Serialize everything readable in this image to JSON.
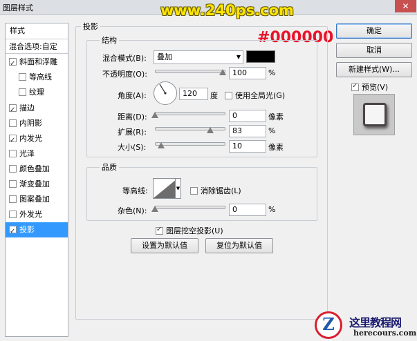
{
  "window": {
    "title": "图层样式",
    "close_glyph": "✕",
    "watermark": "www.240ps.com",
    "color_overlay_text": "#000000"
  },
  "sidebar": {
    "header": "样式",
    "blend_options": "混合选项:自定",
    "items": [
      {
        "label": "斜面和浮雕",
        "checked": true
      },
      {
        "label": "等高线",
        "checked": false
      },
      {
        "label": "纹理",
        "checked": false
      },
      {
        "label": "描边",
        "checked": true
      },
      {
        "label": "内阴影",
        "checked": false
      },
      {
        "label": "内发光",
        "checked": true
      },
      {
        "label": "光泽",
        "checked": false
      },
      {
        "label": "颜色叠加",
        "checked": false
      },
      {
        "label": "渐变叠加",
        "checked": false
      },
      {
        "label": "图案叠加",
        "checked": false
      },
      {
        "label": "外发光",
        "checked": false
      },
      {
        "label": "投影",
        "checked": true
      }
    ],
    "selected_item": "投影"
  },
  "panel": {
    "title": "投影",
    "structure": {
      "title": "结构",
      "blend_mode_label": "混合模式(B):",
      "blend_mode_value": "叠加",
      "shadow_color": "#000000",
      "opacity_label": "不透明度(O):",
      "opacity_value": "100",
      "opacity_unit": "%",
      "angle_label": "角度(A):",
      "angle_value": "120",
      "angle_unit": "度",
      "global_light_label": "使用全局光(G)",
      "global_light_checked": false,
      "distance_label": "距离(D):",
      "distance_value": "0",
      "distance_unit": "像素",
      "spread_label": "扩展(R):",
      "spread_value": "83",
      "spread_unit": "%",
      "size_label": "大小(S):",
      "size_value": "10",
      "size_unit": "像素"
    },
    "quality": {
      "title": "品质",
      "contour_label": "等高线:",
      "antialias_label": "消除锯齿(L)",
      "antialias_checked": false,
      "noise_label": "杂色(N):",
      "noise_value": "0",
      "noise_unit": "%"
    },
    "knockout_label": "图层挖空投影(U)",
    "knockout_checked": true,
    "make_default_button": "设置为默认值",
    "reset_default_button": "复位为默认值"
  },
  "actions": {
    "ok": "确定",
    "cancel": "取消",
    "new_style": "新建样式(W)...",
    "preview_label": "预览(V)",
    "preview_checked": true
  },
  "footer_logo": {
    "letter": "Z",
    "name": "这里教程网",
    "url": "herecours.com"
  }
}
